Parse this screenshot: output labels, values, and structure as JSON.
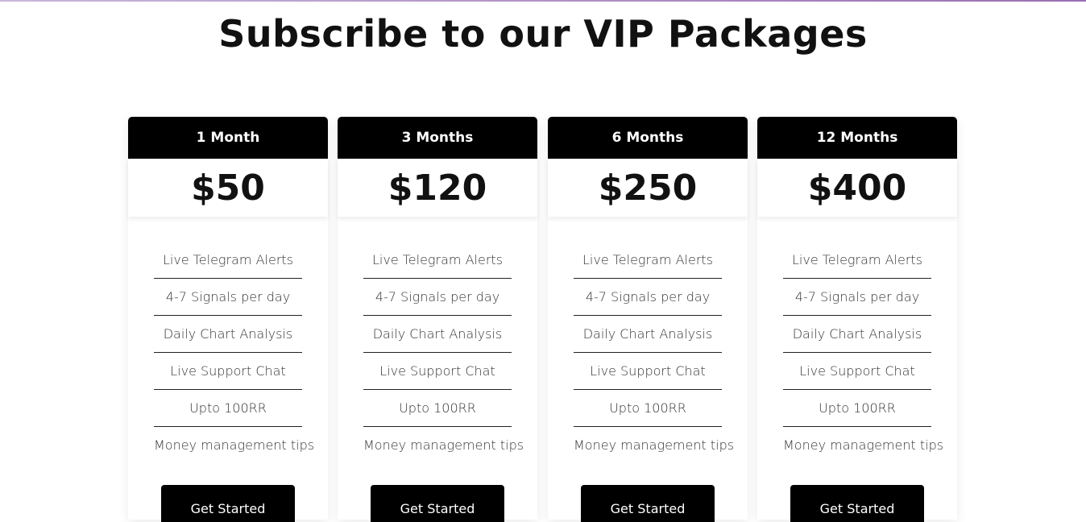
{
  "page": {
    "title": "Subscribe to our VIP Packages"
  },
  "plans": [
    {
      "name": "1 Month",
      "price": "$50",
      "features": [
        "Live Telegram Alerts",
        "4-7 Signals per day",
        "Daily Chart Analysis",
        "Live Support Chat",
        "Upto 100RR",
        "Money management tips"
      ],
      "cta": "Get Started"
    },
    {
      "name": "3 Months",
      "price": "$120",
      "features": [
        "Live Telegram Alerts",
        "4-7 Signals per day",
        "Daily Chart Analysis",
        "Live Support Chat",
        "Upto 100RR",
        "Money management tips"
      ],
      "cta": "Get Started"
    },
    {
      "name": "6 Months",
      "price": "$250",
      "features": [
        "Live Telegram Alerts",
        "4-7 Signals per day",
        "Daily Chart Analysis",
        "Live Support Chat",
        "Upto 100RR",
        "Money management tips"
      ],
      "cta": "Get Started"
    },
    {
      "name": "12 Months",
      "price": "$400",
      "features": [
        "Live Telegram Alerts",
        "4-7 Signals per day",
        "Daily Chart Analysis",
        "Live Support Chat",
        "Upto 100RR",
        "Money management tips"
      ],
      "cta": "Get Started"
    }
  ],
  "colors": {
    "header_bg": "#000000",
    "button_bg": "#000000",
    "accent_line": "#9a6fb5"
  }
}
